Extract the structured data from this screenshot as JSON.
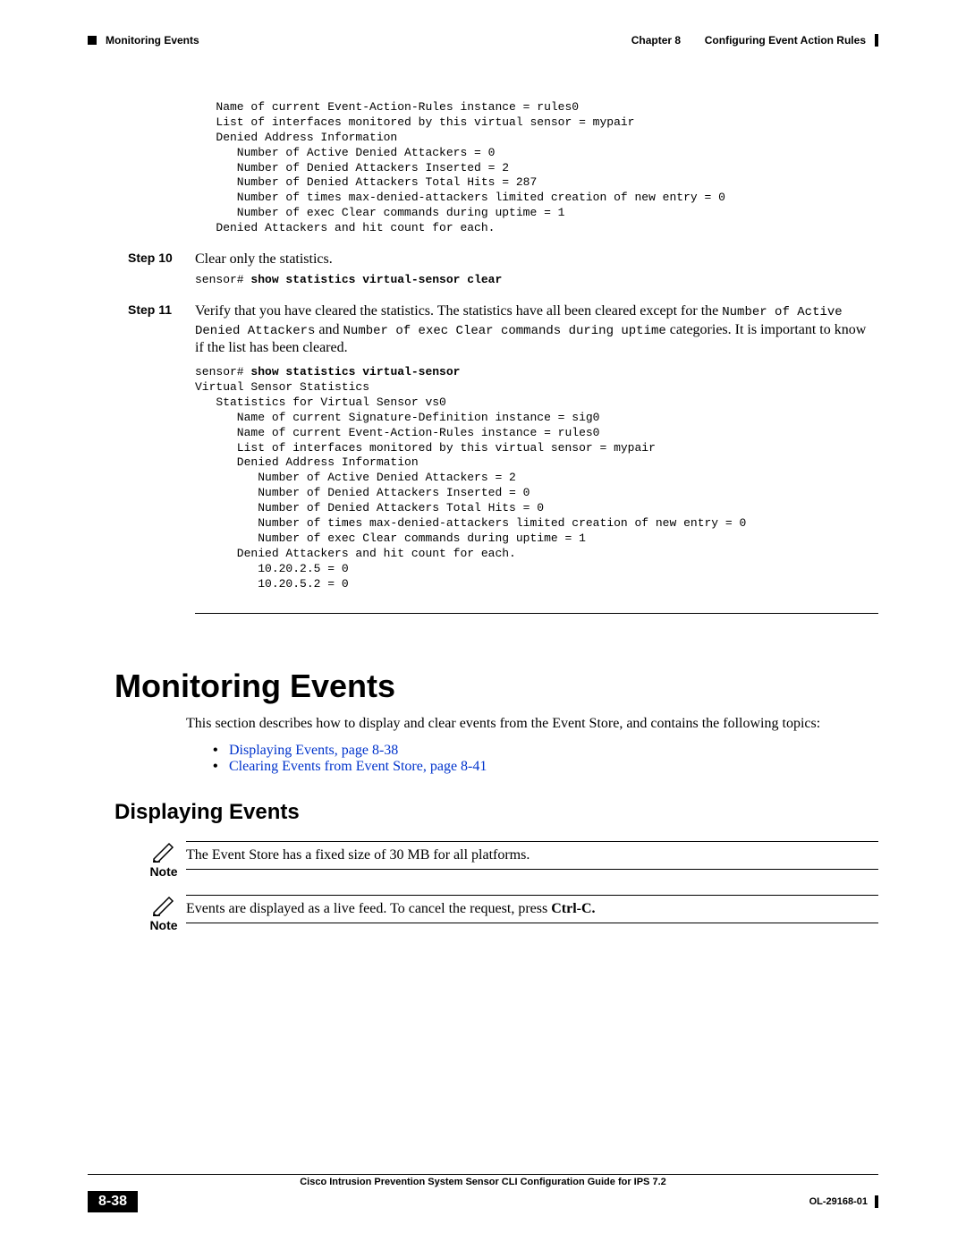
{
  "header": {
    "chapter_label": "Chapter 8",
    "chapter_title": "Configuring Event Action Rules",
    "section_label": "Monitoring Events"
  },
  "code_block_1": "   Name of current Event-Action-Rules instance = rules0\n   List of interfaces monitored by this virtual sensor = mypair\n   Denied Address Information\n      Number of Active Denied Attackers = 0\n      Number of Denied Attackers Inserted = 2\n      Number of Denied Attackers Total Hits = 287\n      Number of times max-denied-attackers limited creation of new entry = 0\n      Number of exec Clear commands during uptime = 1\n   Denied Attackers and hit count for each.",
  "step10": {
    "label": "Step 10",
    "text": "Clear only the statistics.",
    "cmd_prefix": "sensor# ",
    "cmd": "show statistics virtual-sensor clear"
  },
  "step11": {
    "label": "Step 11",
    "text_a": "Verify that you have cleared the statistics. The statistics have all been cleared except for the ",
    "inline1": "Number of Active Denied Attackers",
    "mid1": " and ",
    "inline2": "Number of exec Clear commands during uptime",
    "text_b": " categories. It is important to know if the list has been cleared.",
    "cmd_prefix": "sensor# ",
    "cmd": "show statistics virtual-sensor",
    "output": "Virtual Sensor Statistics\n   Statistics for Virtual Sensor vs0\n      Name of current Signature-Definition instance = sig0\n      Name of current Event-Action-Rules instance = rules0\n      List of interfaces monitored by this virtual sensor = mypair\n      Denied Address Information\n         Number of Active Denied Attackers = 2\n         Number of Denied Attackers Inserted = 0\n         Number of Denied Attackers Total Hits = 0\n         Number of times max-denied-attackers limited creation of new entry = 0\n         Number of exec Clear commands during uptime = 1\n      Denied Attackers and hit count for each.\n         10.20.2.5 = 0\n         10.20.5.2 = 0"
  },
  "h1": "Monitoring Events",
  "intro": "This section describes how to display and clear events from the Event Store, and contains the following topics:",
  "links": [
    "Displaying Events, page 8-38",
    "Clearing Events from Event Store, page 8-41"
  ],
  "h2": "Displaying Events",
  "note1": {
    "label": "Note",
    "text": "The Event Store has a fixed size of 30 MB for all platforms."
  },
  "note2": {
    "label": "Note",
    "text_a": "Events are displayed as a live feed. To cancel the request, press ",
    "bold": "Ctrl-C.",
    "text_b": ""
  },
  "footer": {
    "doc_title": "Cisco Intrusion Prevention System Sensor CLI Configuration Guide for IPS 7.2",
    "page_num": "8-38",
    "doc_id": "OL-29168-01"
  }
}
